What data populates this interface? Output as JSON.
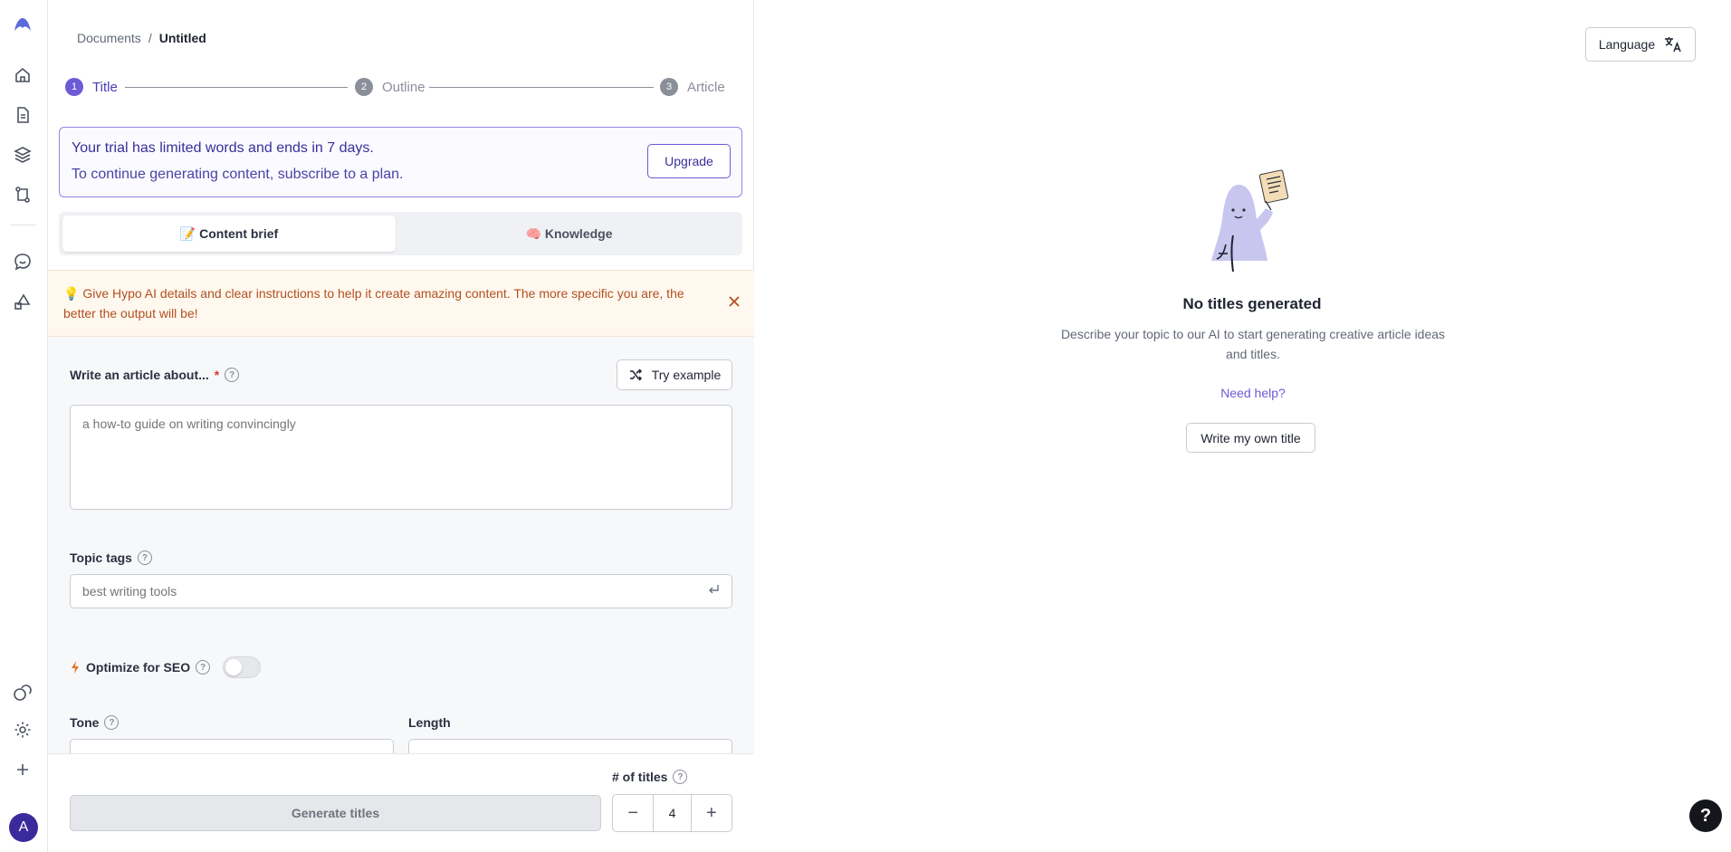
{
  "rail": {
    "icons": [
      "logo-icon",
      "home-icon",
      "document-icon",
      "layers-icon",
      "workflow-icon",
      "chat-icon",
      "shapes-icon",
      "chat-bubbles-icon",
      "gear-icon",
      "plus-icon"
    ],
    "avatar_initial": "A"
  },
  "breadcrumb": {
    "parent": "Documents",
    "separator": "/",
    "current": "Untitled"
  },
  "stepper": {
    "steps": [
      {
        "number": "1",
        "label": "Title"
      },
      {
        "number": "2",
        "label": "Outline"
      },
      {
        "number": "3",
        "label": "Article"
      }
    ]
  },
  "trial": {
    "line1": "Your trial has limited words and ends in 7 days.",
    "line2": "To continue generating content, subscribe to a plan.",
    "upgrade_label": "Upgrade"
  },
  "tabs": [
    {
      "emoji": "📝",
      "label": "Content brief"
    },
    {
      "emoji": "🧠",
      "label": "Knowledge"
    }
  ],
  "tip": {
    "emoji": "💡",
    "text": "Give Hypo AI details and clear instructions to help it create amazing content. The more specific you are, the better the output will be!"
  },
  "form": {
    "about_label": "Write an article about...",
    "required_mark": "*",
    "try_example_label": "Try example",
    "about_placeholder": "a how-to guide on writing convincingly",
    "topic_tags_label": "Topic tags",
    "topic_tags_placeholder": "best writing tools",
    "seo_label": "Optimize for SEO",
    "seo_enabled": false,
    "tone_label": "Tone",
    "length_label": "Length"
  },
  "bottom": {
    "generate_label": "Generate titles",
    "count_label": "# of titles",
    "count_value": "4",
    "minus": "−",
    "plus": "+"
  },
  "right": {
    "language_label": "Language",
    "empty_title": "No titles generated",
    "empty_desc": "Describe your topic to our AI to start generating creative article ideas and titles.",
    "need_help": "Need help?",
    "own_title_label": "Write my own title",
    "help_fab": "?"
  },
  "colors": {
    "accent": "#6c5ad6",
    "trial_border": "#8f86e0",
    "tip_text": "#b2501e",
    "tip_bg": "#fff8ef"
  }
}
